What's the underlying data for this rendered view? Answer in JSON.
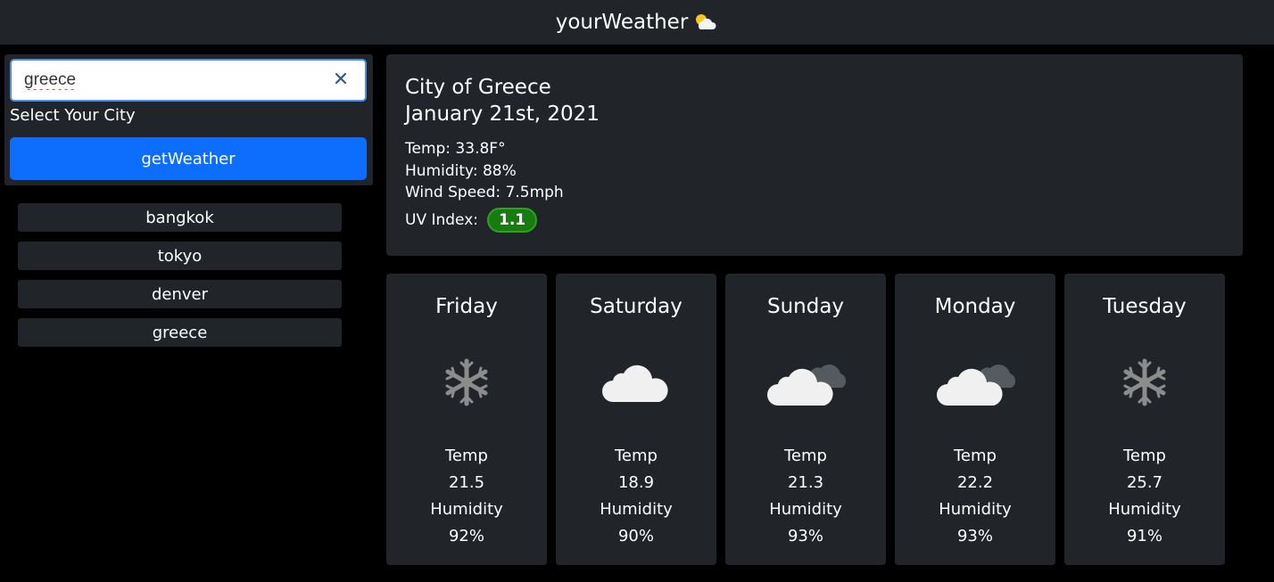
{
  "app": {
    "title": "yourWeather",
    "logo_icon": "sun-behind-cloud-icon"
  },
  "search": {
    "value": "greece",
    "label": "Select Your City",
    "button_label": "getWeather"
  },
  "history": [
    "bangkok",
    "tokyo",
    "denver",
    "greece"
  ],
  "current": {
    "city": "City of Greece",
    "date": "January 21st, 2021",
    "temp": "Temp: 33.8F°",
    "humidity": "Humidity: 88%",
    "wind": "Wind Speed: 7.5mph",
    "uv_label": "UV Index:",
    "uv_value": "1.1"
  },
  "forecast": [
    {
      "day": "Friday",
      "icon": "snowflake-icon",
      "temp_label": "Temp",
      "temp": "21.5",
      "humidity_label": "Humidity",
      "humidity": "92%"
    },
    {
      "day": "Saturday",
      "icon": "cloud-icon",
      "temp_label": "Temp",
      "temp": "18.9",
      "humidity_label": "Humidity",
      "humidity": "90%"
    },
    {
      "day": "Sunday",
      "icon": "broken-clouds-icon",
      "temp_label": "Temp",
      "temp": "21.3",
      "humidity_label": "Humidity",
      "humidity": "93%"
    },
    {
      "day": "Monday",
      "icon": "broken-clouds-icon",
      "temp_label": "Temp",
      "temp": "22.2",
      "humidity_label": "Humidity",
      "humidity": "93%"
    },
    {
      "day": "Tuesday",
      "icon": "snowflake-icon",
      "temp_label": "Temp",
      "temp": "25.7",
      "humidity_label": "Humidity",
      "humidity": "91%"
    }
  ],
  "colors": {
    "accent": "#0d6efd",
    "panel": "#212529",
    "uv_badge": "#1a7a12"
  }
}
